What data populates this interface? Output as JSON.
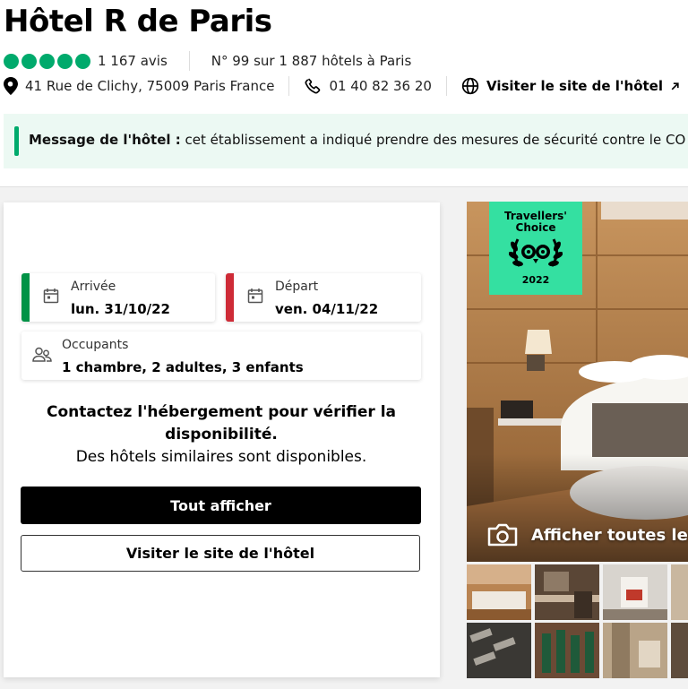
{
  "hotel": {
    "name": "Hôtel R de Paris",
    "reviews": "1 167 avis",
    "ranking": "N° 99 sur 1 887 hôtels à Paris",
    "address": "41 Rue de Clichy, 75009 Paris France",
    "phone": "01 40 82 36 20",
    "website_link": "Visiter le site de l'hôtel",
    "rating_bubbles": 5
  },
  "message": {
    "label": "Message de l'hôtel :",
    "text": " cet établissement a indiqué prendre des mesures de sécurité contre le CO"
  },
  "booking": {
    "checkin_label": "Arrivée",
    "checkin_value": "lun. 31/10/22",
    "checkout_label": "Départ",
    "checkout_value": "ven. 04/11/22",
    "guests_label": "Occupants",
    "guests_value": "1 chambre, 2 adultes, 3 enfants",
    "contact_bold": "Contactez l'hébergement pour vérifier la disponibilité.",
    "contact_text": "Des hôtels similaires sont disponibles.",
    "primary_button": "Tout afficher",
    "secondary_button": "Visiter le site de l'hôtel"
  },
  "gallery": {
    "badge_title": "Travellers' Choice",
    "badge_year": "2022",
    "show_all": "Afficher toutes les p"
  },
  "colors": {
    "accent_green": "#00aa6c",
    "badge_green": "#34e0a1",
    "message_bg": "#ecf9f3",
    "flag_green": "#009246",
    "flag_red": "#ce2b37"
  },
  "icons": [
    "location-pin-icon",
    "phone-icon",
    "globe-icon",
    "external-arrow-icon",
    "calendar-icon",
    "people-icon",
    "camera-icon",
    "owl-icon"
  ]
}
